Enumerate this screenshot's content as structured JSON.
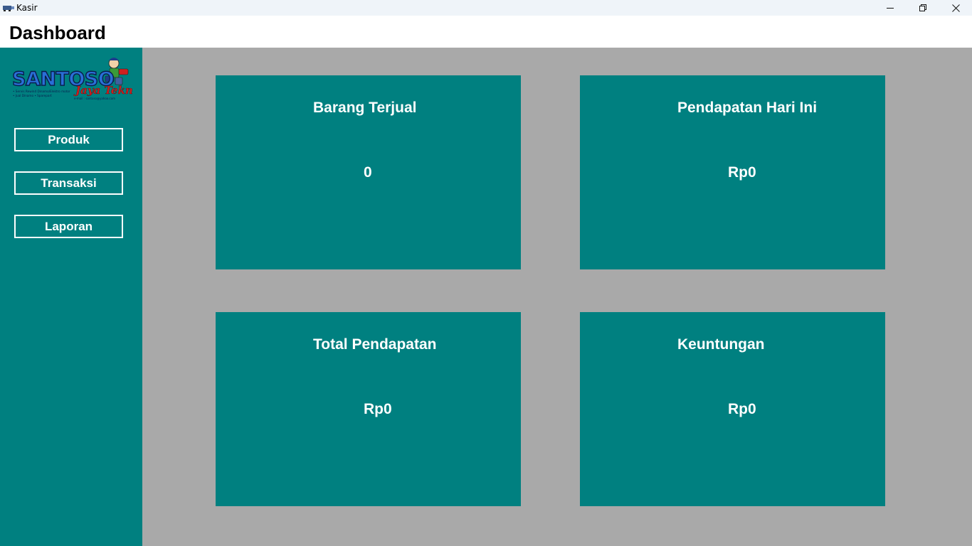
{
  "window": {
    "title": "Kasir",
    "controls": {
      "minimize": "—",
      "restore": "❐",
      "close": "✕"
    }
  },
  "header": {
    "title": "Dashboard"
  },
  "sidebar": {
    "logo": {
      "brand": "SANTOSO",
      "tagline": "Jaya Teknik",
      "lines": [
        "• Servis Rewind Dinamo/Elektro motor",
        "• Jual Dinamo   • Sparepart"
      ],
      "email": "e-mail : santoso@yahoo.com"
    },
    "items": [
      {
        "label": "Produk"
      },
      {
        "label": "Transaksi"
      },
      {
        "label": "Laporan"
      }
    ]
  },
  "cards": [
    {
      "title": "Barang Terjual",
      "value": "0"
    },
    {
      "title": "Pendapatan Hari Ini",
      "value": "Rp0"
    },
    {
      "title": "Total Pendapatan",
      "value": "Rp0"
    },
    {
      "title": "Keuntungan",
      "value": "Rp0"
    }
  ],
  "colors": {
    "sidebar": "#008080",
    "card": "#008080",
    "background": "#a9a9a9",
    "text": "#ffffff"
  }
}
